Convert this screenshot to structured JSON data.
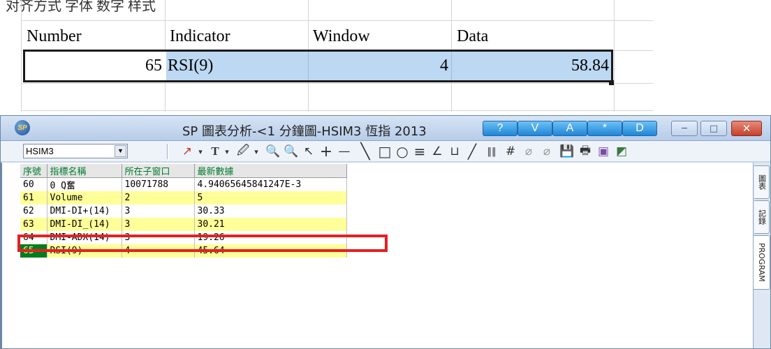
{
  "sheet": {
    "top_text": "对齐方式 字体 数字 样式",
    "headers": [
      "Number",
      "Indicator",
      "Window",
      "Data"
    ],
    "row": {
      "number": "65",
      "indicator": "RSI(9)",
      "window": "4",
      "data": "58.84"
    }
  },
  "window": {
    "title": "SP 圖表分析-<1 分鐘圖-HSIM3 恆指 2013",
    "title_buttons": [
      "?",
      "V",
      "A",
      "*",
      "D"
    ],
    "controls": {
      "minimize": "─",
      "maximize": "□",
      "close": "✕"
    }
  },
  "toolbar": {
    "symbol": "HSIM3",
    "tools": [
      "↗",
      "▾",
      "T",
      "▾",
      "🖉",
      "▾",
      "🔍",
      "🔍",
      "↖",
      "+",
      "—",
      "╲",
      "□",
      "○",
      "≡",
      "∠",
      "⊔",
      "╱",
      "‖‖",
      "#",
      "⌀",
      "⌀",
      "💾",
      "🖶",
      "▣",
      "◩"
    ]
  },
  "indicator_table": {
    "headers": [
      "序號",
      "指標名稱",
      "所在子窗口",
      "最新數據"
    ],
    "rows": [
      {
        "no": "60",
        "name": "0  Q奮",
        "window": "10071788",
        "data": "4.94065645841247E-3"
      },
      {
        "no": "61",
        "name": "Volume",
        "window": "2",
        "data": "5"
      },
      {
        "no": "62",
        "name": "DMI-DI+(14)",
        "window": "3",
        "data": "30.33"
      },
      {
        "no": "63",
        "name": "DMI-DI_(14)",
        "window": "3",
        "data": "30.21"
      },
      {
        "no": "64",
        "name": "DMI-ADX(14)",
        "window": "3",
        "data": "19.26"
      },
      {
        "no": "65",
        "name": "RSI(9)",
        "window": "4",
        "data": "45.64"
      }
    ]
  },
  "side_tabs": [
    "圖表",
    "記錄",
    "PROGRAM"
  ],
  "colors": {
    "highlight_red": "#e32022",
    "selected_green": "#007d1e",
    "row_yellow": "#ffff99",
    "excel_selection": "#bcd8f2"
  }
}
